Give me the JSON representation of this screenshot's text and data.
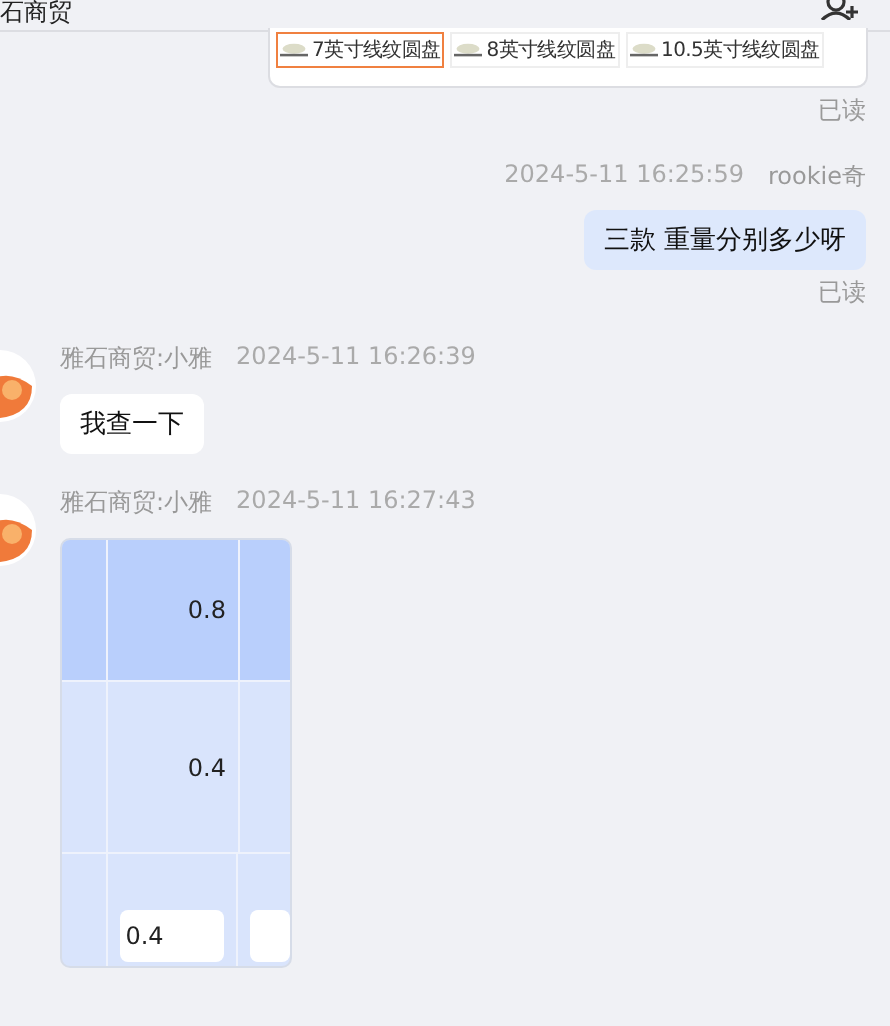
{
  "header": {
    "title": "石商贸"
  },
  "product_card": {
    "items": [
      {
        "label": "7英寸线纹圆盘",
        "selected": true
      },
      {
        "label": "8英寸线纹圆盘",
        "selected": false
      },
      {
        "label": "10.5英寸线纹圆盘",
        "selected": false
      }
    ],
    "read_status": "已读"
  },
  "messages": [
    {
      "kind": "outgoing",
      "time": "2024-5-11 16:25:59",
      "sender": "rookie奇",
      "text": "三款 重量分别多少呀",
      "read_status": "已读"
    },
    {
      "kind": "incoming",
      "sender": "雅石商贸:小雅",
      "time": "2024-5-11 16:26:39",
      "text": "我查一下"
    },
    {
      "kind": "table",
      "sender": "雅石商贸:小雅",
      "time": "2024-5-11 16:27:43",
      "rows": [
        {
          "selected": true,
          "value": "0.8"
        },
        {
          "selected": false,
          "value": "0.4"
        }
      ],
      "input_value": "0.4"
    }
  ]
}
